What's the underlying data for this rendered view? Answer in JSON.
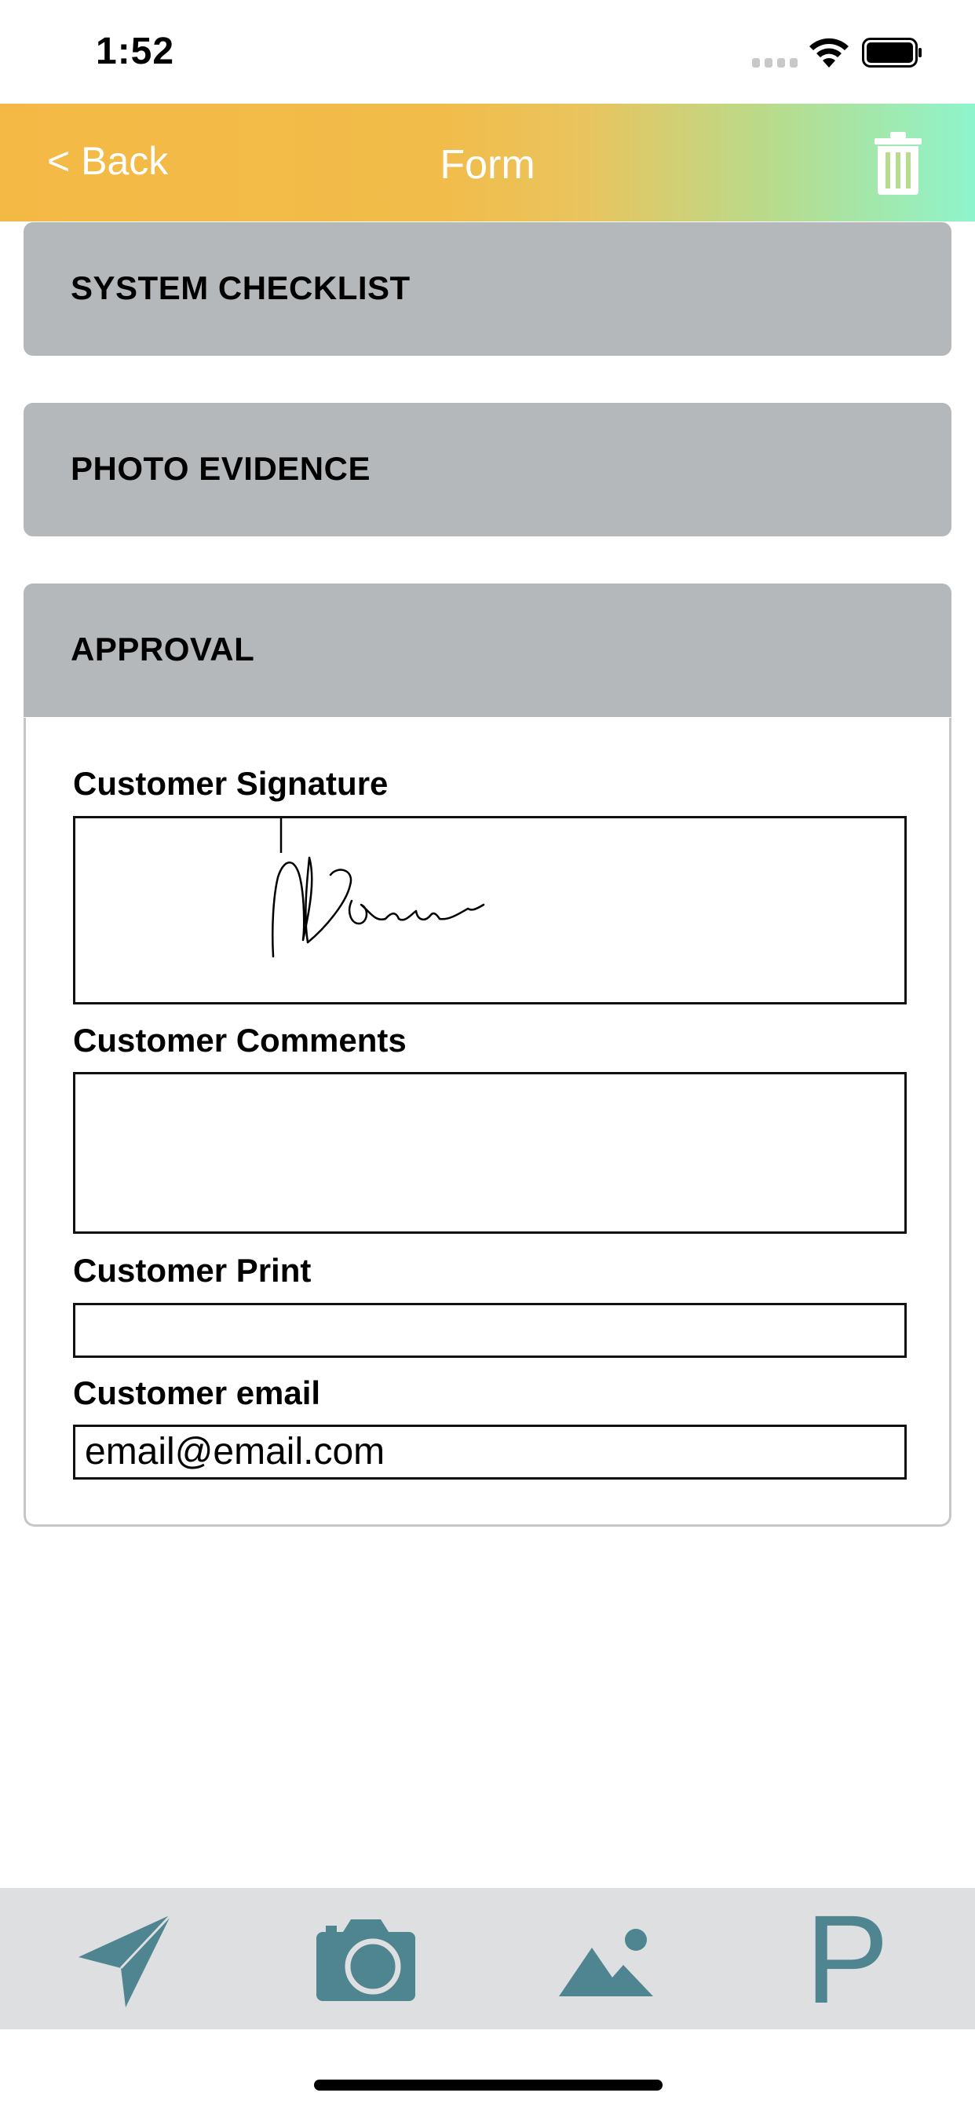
{
  "status_bar": {
    "time": "1:52"
  },
  "nav": {
    "back_label": "< Back",
    "title": "Form",
    "delete_icon": "trash-icon"
  },
  "sections": {
    "system_checklist": "SYSTEM CHECKLIST",
    "photo_evidence": "PHOTO EVIDENCE",
    "approval": "APPROVAL"
  },
  "approval": {
    "signature_label": "Customer Signature",
    "comments_label": "Customer Comments",
    "comments_value": "",
    "print_label": "Customer Print",
    "print_value": "",
    "email_label": "Customer email",
    "email_value": "email@email.com"
  },
  "toolbar": {
    "icons": [
      "send-icon",
      "camera-icon",
      "image-icon",
      "p-icon"
    ],
    "p_label": "P",
    "accent": "#4e8591"
  },
  "colors": {
    "nav_start": "#f4b945",
    "nav_end": "#8ef4cc",
    "section_bg": "#b4b8bb",
    "toolbar_bg": "#dedfe0"
  }
}
